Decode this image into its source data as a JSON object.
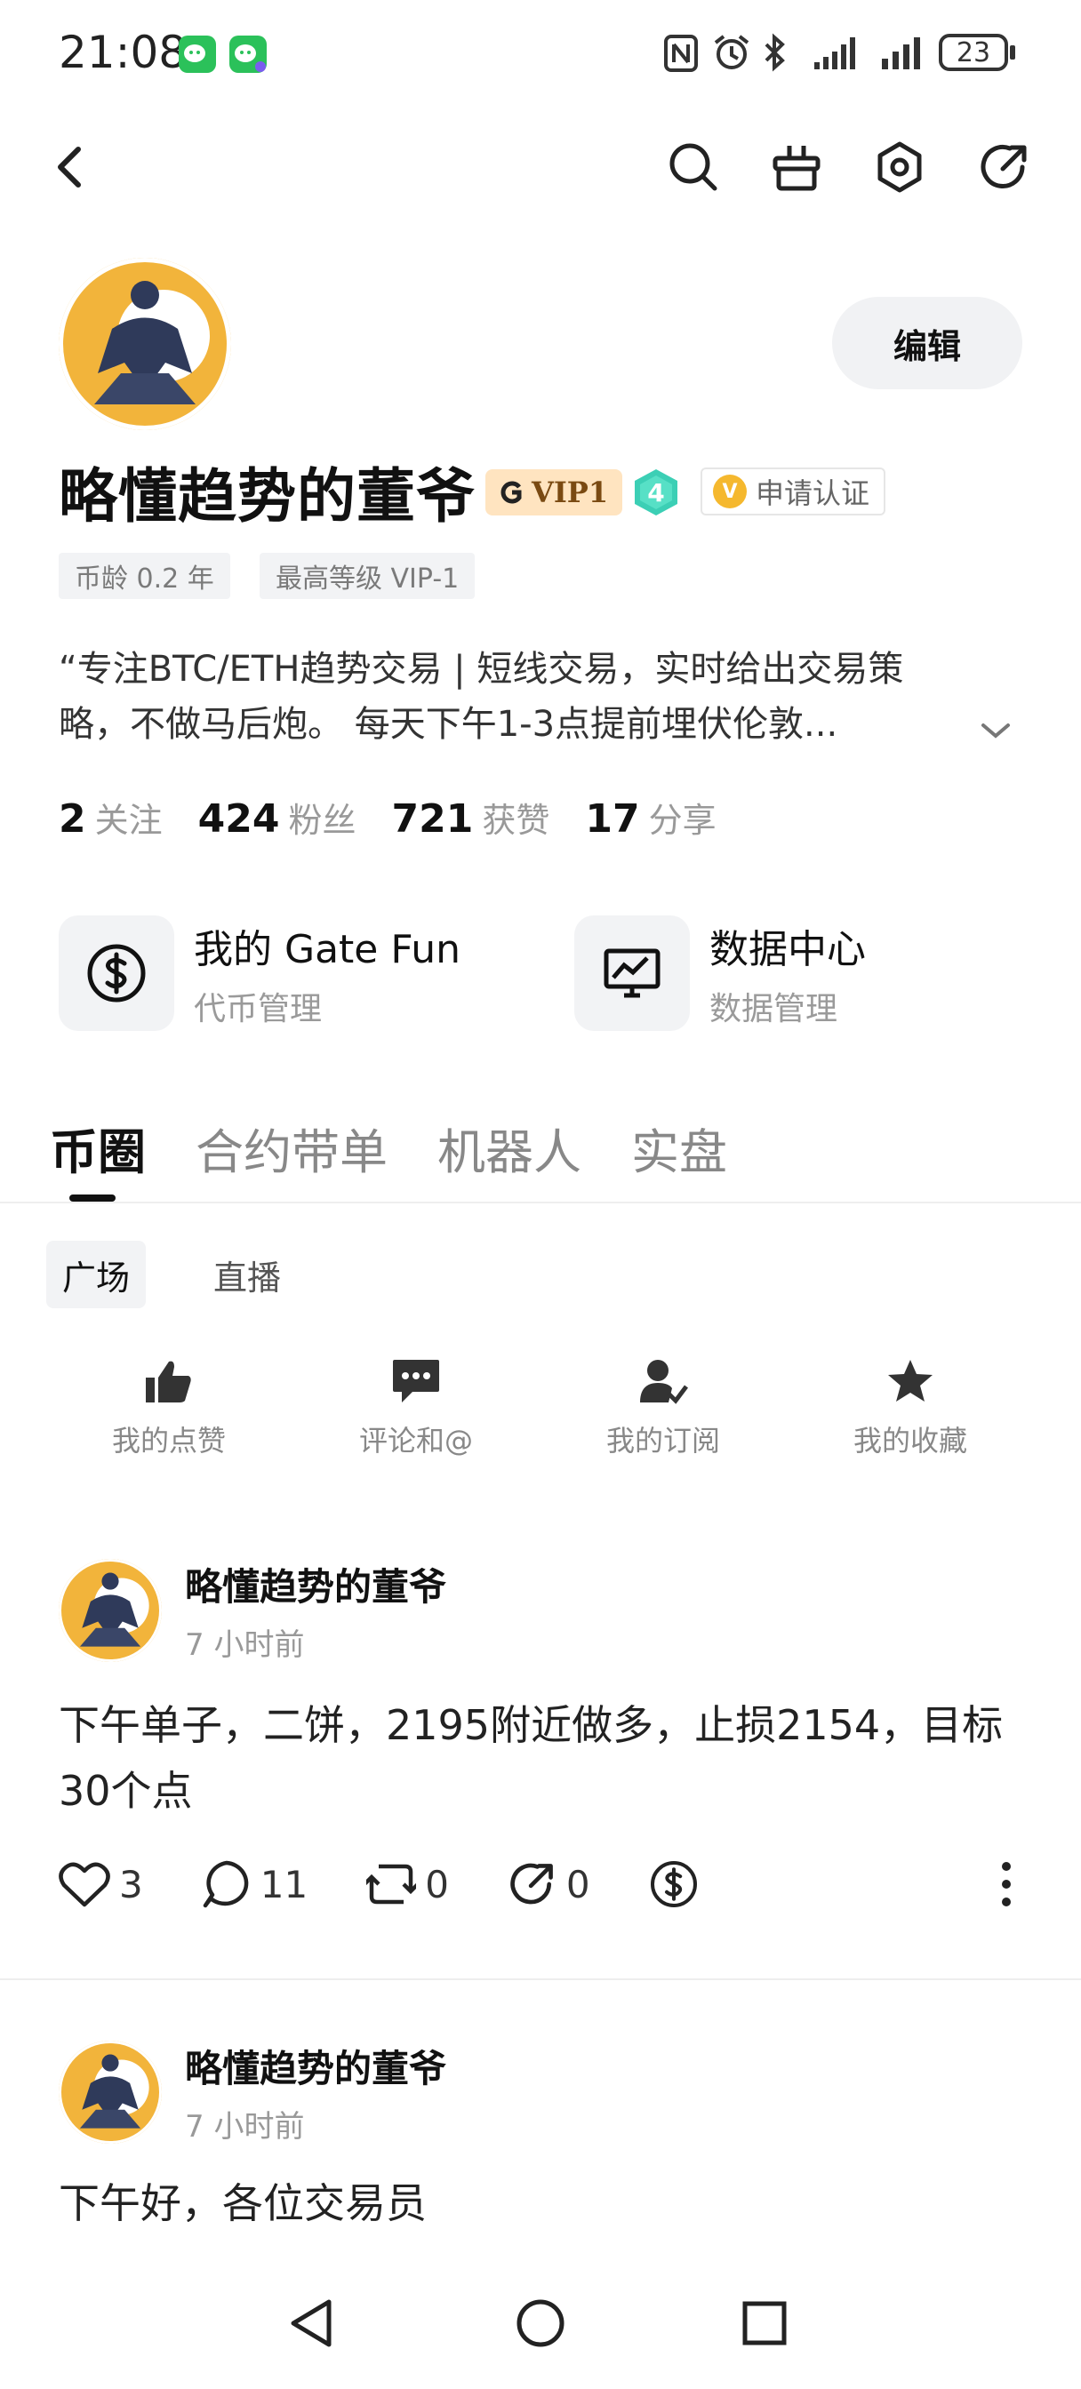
{
  "status_bar": {
    "time": "21:08",
    "battery": "23",
    "icons": [
      "wechat-icon",
      "wechat-icon",
      "nfc-icon",
      "alarm-icon",
      "bluetooth-icon",
      "signal-icon",
      "signal-icon",
      "battery-icon"
    ]
  },
  "top_nav": {
    "icons": [
      "back-icon",
      "search-icon",
      "gift-icon",
      "settings-icon",
      "share-icon"
    ]
  },
  "profile": {
    "edit_label": "编辑",
    "name": "略懂趋势的董爷",
    "vip_label": "VIP1",
    "level": "4",
    "cert_label": "申请认证",
    "cert_badge": "V",
    "tags": [
      "币龄 0.2 年",
      "最高等级 VIP-1"
    ],
    "bio_line1": "“专注BTC/ETH趋势交易 | 短线交易，实时给出交易策",
    "bio_line2": "略，不做马后炮。 每天下午1-3点提前埋伏伦敦...",
    "stats": [
      {
        "num": "2",
        "label": "关注"
      },
      {
        "num": "424",
        "label": "粉丝"
      },
      {
        "num": "721",
        "label": "获赞"
      },
      {
        "num": "17",
        "label": "分享"
      }
    ]
  },
  "tools": [
    {
      "title": "我的 Gate Fun",
      "subtitle": "代币管理",
      "icon": "dollar-circle-icon"
    },
    {
      "title": "数据中心",
      "subtitle": "数据管理",
      "icon": "chart-monitor-icon"
    }
  ],
  "tabs": [
    "币圈",
    "合约带单",
    "机器人",
    "实盘"
  ],
  "active_tab": "币圈",
  "subtabs": [
    "广场",
    "直播"
  ],
  "quick_actions": [
    {
      "label": "我的点赞",
      "icon": "thumbs-up-icon"
    },
    {
      "label": "评论和@",
      "icon": "comment-icon"
    },
    {
      "label": "我的订阅",
      "icon": "subscribe-icon"
    },
    {
      "label": "我的收藏",
      "icon": "star-icon"
    }
  ],
  "posts": [
    {
      "author": "略懂趋势的董爷",
      "time": "7 小时前",
      "text": "下午单子，二饼，2195附近做多，止损2154，目标30个点",
      "likes": "3",
      "comments": "11",
      "reposts": "0",
      "shares": "0"
    },
    {
      "author": "略懂趋势的董爷",
      "time": "7 小时前",
      "text": "下午好，各位交易员"
    }
  ],
  "colors": {
    "accent_dark": "#111111",
    "avatar_bg": "#f2b43b",
    "vip_bg": "#ffe4c0",
    "level_badge": "#3ccfb5"
  }
}
